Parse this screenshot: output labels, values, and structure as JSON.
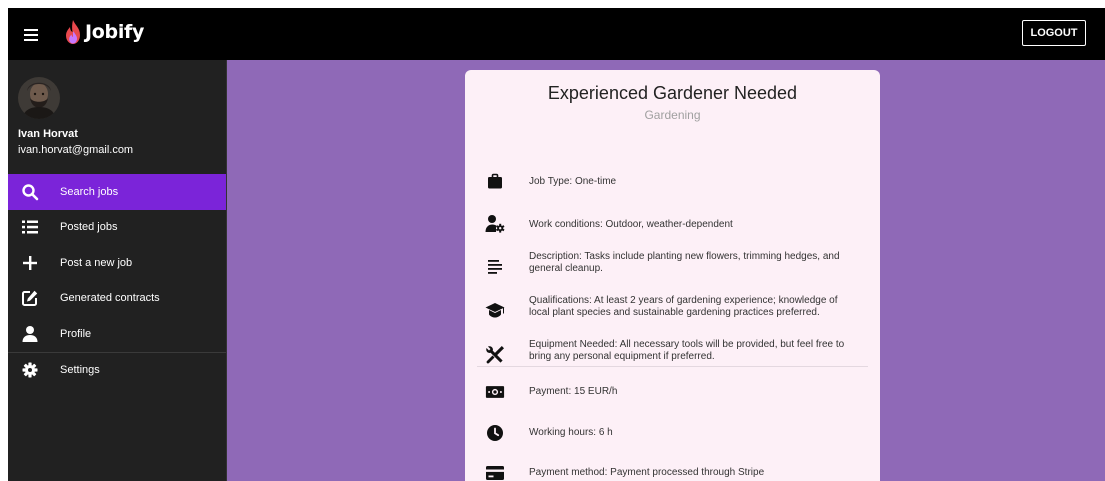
{
  "app": {
    "logo_text": "Jobify",
    "logout_label": "LOGOUT",
    "colors": {
      "topbar": "#000000",
      "sidebar": "#212121",
      "active_nav": "#7b24d9",
      "main_bg": "#8f69b7",
      "card_bg": "#fdf0f7"
    }
  },
  "user": {
    "name": "Ivan Horvat",
    "email": "ivan.horvat@gmail.com"
  },
  "sidebar": {
    "items": [
      {
        "label": "Search jobs",
        "icon": "search-icon",
        "active": true
      },
      {
        "label": "Posted jobs",
        "icon": "list-icon",
        "active": false
      },
      {
        "label": "Post a new job",
        "icon": "plus-icon",
        "active": false
      },
      {
        "label": "Generated contracts",
        "icon": "edit-icon",
        "active": false
      },
      {
        "label": "Profile",
        "icon": "person-icon",
        "active": false
      },
      {
        "label": "Settings",
        "icon": "gear-icon",
        "active": false
      }
    ]
  },
  "job": {
    "title": "Experienced Gardener Needed",
    "category": "Gardening",
    "details": [
      {
        "icon": "briefcase-icon",
        "text": "Job Type: One-time"
      },
      {
        "icon": "person-gear-icon",
        "text": "Work conditions: Outdoor, weather-dependent"
      },
      {
        "icon": "subject-icon",
        "text": "Description: Tasks include planting new flowers, trimming hedges, and general cleanup."
      },
      {
        "icon": "graduation-cap-icon",
        "text": "Qualifications: At least 2 years of gardening experience; knowledge of local plant species and sustainable gardening practices preferred."
      },
      {
        "icon": "tools-icon",
        "text": "Equipment Needed: All necessary tools will be provided, but feel free to bring any personal equipment if preferred."
      },
      {
        "icon": "money-icon",
        "text": "Payment: 15 EUR/h"
      },
      {
        "icon": "clock-icon",
        "text": "Working hours: 6 h"
      },
      {
        "icon": "credit-card-icon",
        "text": "Payment method: Payment processed through Stripe"
      }
    ]
  }
}
